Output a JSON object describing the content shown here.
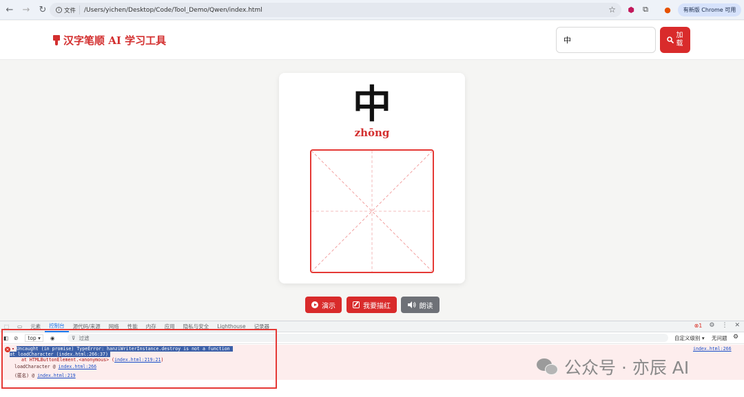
{
  "browser": {
    "file_label": "文件",
    "url": "/Users/yichen/Desktop/Code/Tool_Demo/Qwen/index.html",
    "update_label": "有新版 Chrome 可用"
  },
  "app": {
    "title": "汉字笔顺 AI 学习工具",
    "search_value": "中",
    "load_label": "加载"
  },
  "card": {
    "character": "中",
    "pinyin": "zhōng"
  },
  "actions": {
    "demo": "演示",
    "trace": "我要描红",
    "read": "朗读"
  },
  "devtools": {
    "tabs": [
      "元素",
      "控制台",
      "源代码/来源",
      "网络",
      "性能",
      "内存",
      "应用",
      "隐私与安全",
      "Lighthouse",
      "记录器"
    ],
    "error_count": "1",
    "context": "top",
    "filter_placeholder": "过滤",
    "level": "自定义级别",
    "issues": "无问题",
    "source_link": "index.html:266",
    "console_lines": {
      "error_main": "Uncaught (in promise) TypeError: hanziWriterInstance.destroy is not a function",
      "at_load": "    at loadCharacter (index.html:266:37)",
      "at_button_prefix": "at HTMLButtonElement.<anonymous> (",
      "at_button_link": "index.html:219:21",
      "at_button_suffix": ")",
      "stack1_fn": "loadCharacter @",
      "stack1_link": "index.html:266",
      "stack2_fn": "(匿名)        @",
      "stack2_link": "index.html:219"
    }
  },
  "watermark": {
    "text": "公众号 · 亦辰 AI"
  }
}
